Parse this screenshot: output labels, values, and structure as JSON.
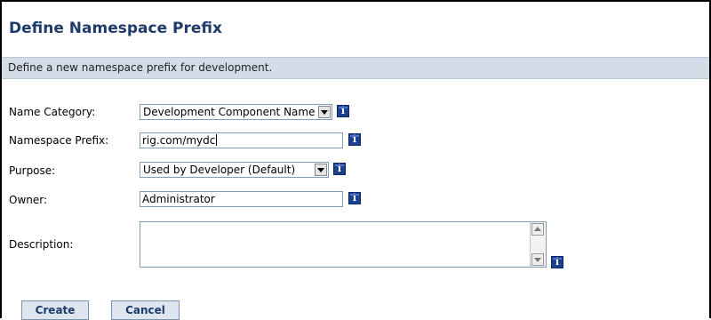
{
  "page": {
    "title": "Define Namespace Prefix",
    "subtitle": "Define a new namespace prefix for development."
  },
  "form": {
    "name_category": {
      "label": "Name Category:",
      "value": "Development Component Name"
    },
    "namespace_prefix": {
      "label": "Namespace Prefix:",
      "value": "rig.com/mydc"
    },
    "purpose": {
      "label": "Purpose:",
      "value": "Used by Developer (Default)"
    },
    "owner": {
      "label": "Owner:",
      "value": "Administrator"
    },
    "description": {
      "label": "Description:",
      "value": ""
    }
  },
  "buttons": {
    "create": "Create",
    "cancel": "Cancel"
  },
  "colors": {
    "title": "#1f3b6b",
    "subtitle_bar": "#d2dde8",
    "info_icon": "#1d3f8f",
    "button_bg": "#dde6ef"
  }
}
